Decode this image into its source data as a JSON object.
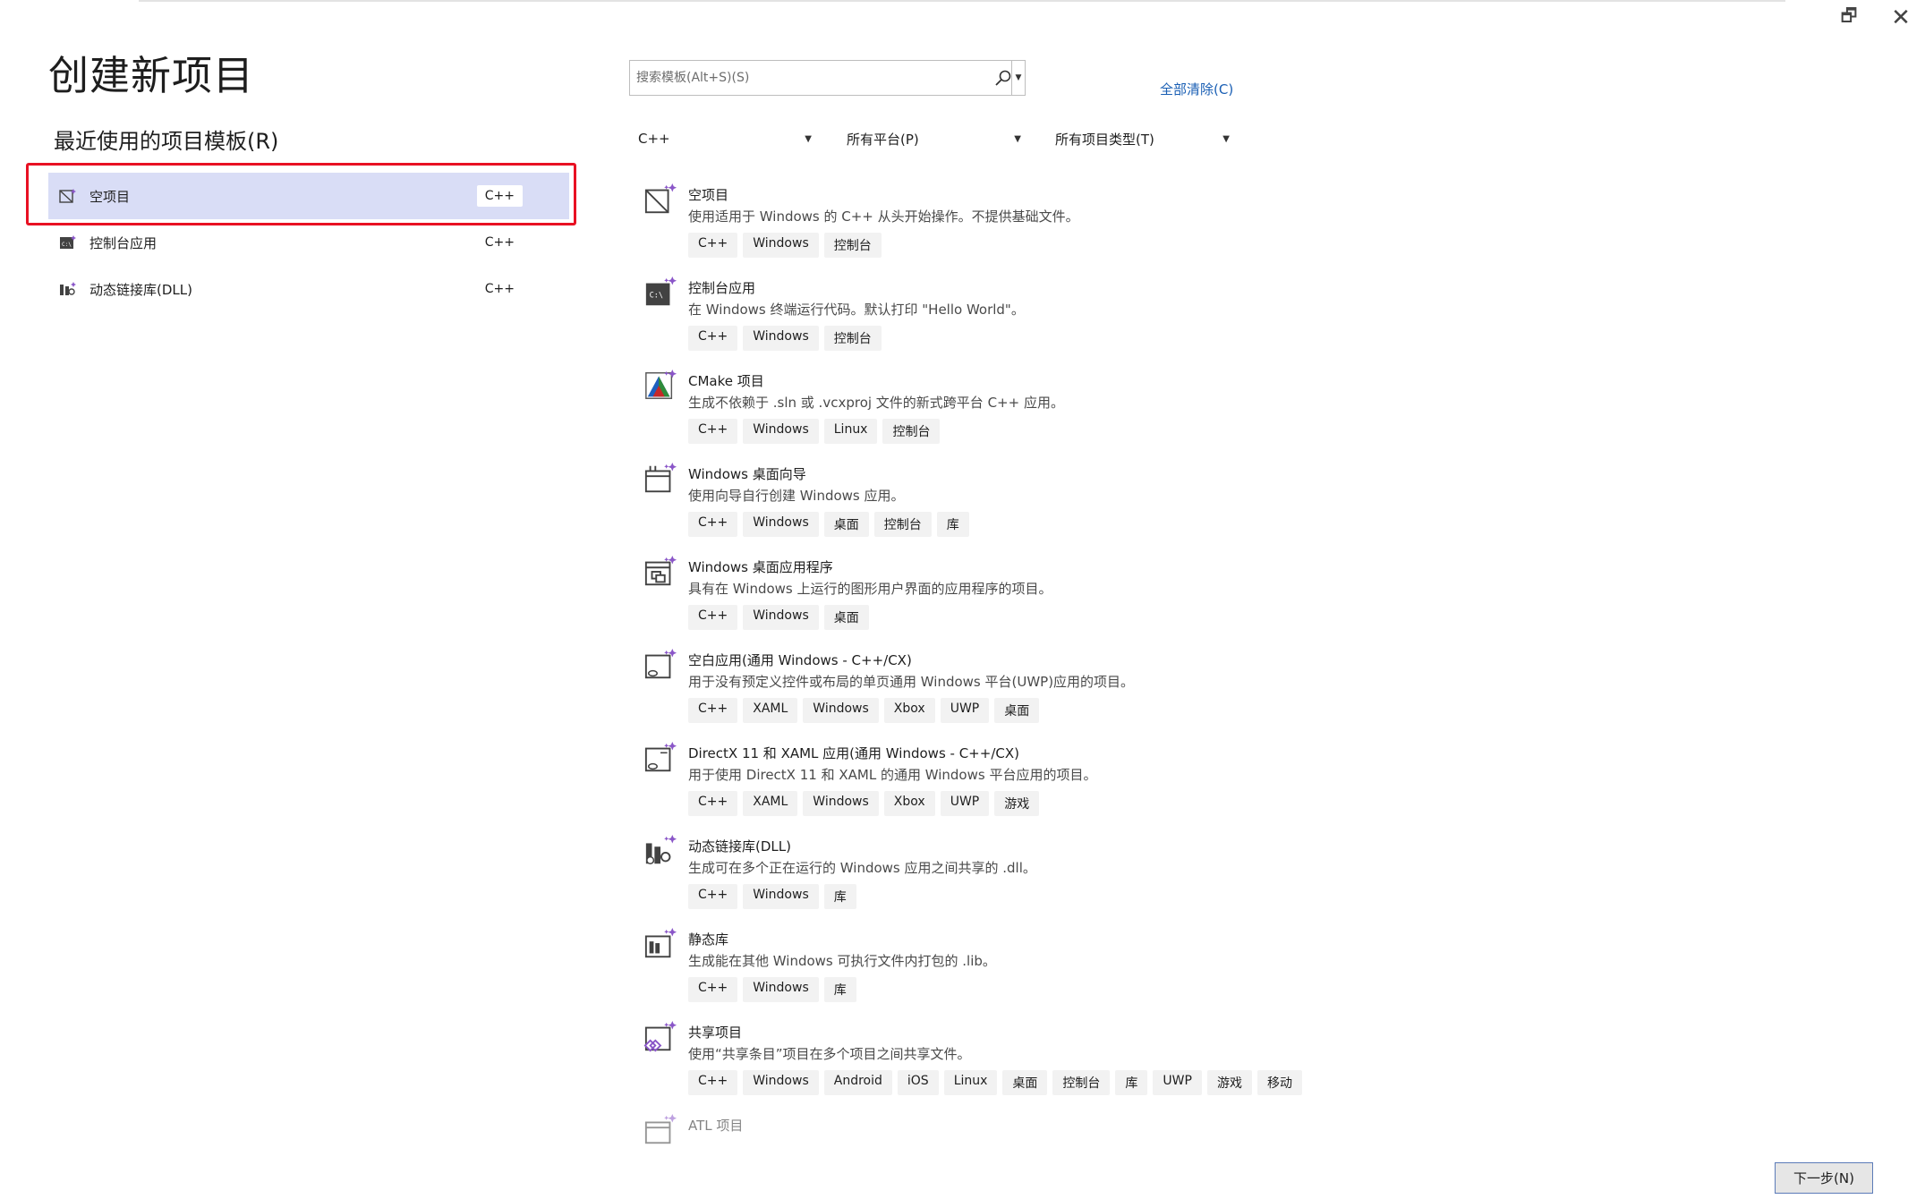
{
  "window": {
    "restore_glyph": "🗗",
    "close_glyph": "✕"
  },
  "page_title": "创建新项目",
  "recent": {
    "title": "最近使用的项目模板(R)",
    "items": [
      {
        "label": "空项目",
        "lang": "C++",
        "icon": "empty-project-icon",
        "selected": true
      },
      {
        "label": "控制台应用",
        "lang": "C++",
        "icon": "console-app-icon",
        "selected": false
      },
      {
        "label": "动态链接库(DLL)",
        "lang": "C++",
        "icon": "dll-icon",
        "selected": false
      }
    ]
  },
  "search": {
    "placeholder": "搜索模板(Alt+S)(S)",
    "value": ""
  },
  "clear_all": "全部清除(C)",
  "filters": {
    "language": "C++",
    "platform": "所有平台(P)",
    "project_type": "所有项目类型(T)"
  },
  "templates": [
    {
      "name": "空项目",
      "desc": "使用适用于 Windows 的 C++ 从头开始操作。不提供基础文件。",
      "tags": [
        "C++",
        "Windows",
        "控制台"
      ],
      "icon": "empty-project-icon"
    },
    {
      "name": "控制台应用",
      "desc": "在 Windows 终端运行代码。默认打印 \"Hello World\"。",
      "tags": [
        "C++",
        "Windows",
        "控制台"
      ],
      "icon": "console-app-icon"
    },
    {
      "name": "CMake 项目",
      "desc": "生成不依赖于 .sln 或 .vcxproj 文件的新式跨平台 C++ 应用。",
      "tags": [
        "C++",
        "Windows",
        "Linux",
        "控制台"
      ],
      "icon": "cmake-icon"
    },
    {
      "name": "Windows 桌面向导",
      "desc": "使用向导自行创建 Windows 应用。",
      "tags": [
        "C++",
        "Windows",
        "桌面",
        "控制台",
        "库"
      ],
      "icon": "desktop-wizard-icon"
    },
    {
      "name": "Windows 桌面应用程序",
      "desc": "具有在 Windows 上运行的图形用户界面的应用程序的项目。",
      "tags": [
        "C++",
        "Windows",
        "桌面"
      ],
      "icon": "desktop-app-icon"
    },
    {
      "name": "空白应用(通用 Windows - C++/CX)",
      "desc": "用于没有预定义控件或布局的单页通用 Windows 平台(UWP)应用的项目。",
      "tags": [
        "C++",
        "XAML",
        "Windows",
        "Xbox",
        "UWP",
        "桌面"
      ],
      "icon": "uwp-blank-app-icon"
    },
    {
      "name": "DirectX 11 和 XAML 应用(通用 Windows - C++/CX)",
      "desc": "用于使用 DirectX 11 和 XAML 的通用 Windows 平台应用的项目。",
      "tags": [
        "C++",
        "XAML",
        "Windows",
        "Xbox",
        "UWP",
        "游戏"
      ],
      "icon": "directx-app-icon"
    },
    {
      "name": "动态链接库(DLL)",
      "desc": "生成可在多个正在运行的 Windows 应用之间共享的 .dll。",
      "tags": [
        "C++",
        "Windows",
        "库"
      ],
      "icon": "dll-icon"
    },
    {
      "name": "静态库",
      "desc": "生成能在其他 Windows 可执行文件内打包的 .lib。",
      "tags": [
        "C++",
        "Windows",
        "库"
      ],
      "icon": "static-lib-icon"
    },
    {
      "name": "共享项目",
      "desc": "使用“共享条目”项目在多个项目之间共享文件。",
      "tags": [
        "C++",
        "Windows",
        "Android",
        "iOS",
        "Linux",
        "桌面",
        "控制台",
        "库",
        "UWP",
        "游戏",
        "移动"
      ],
      "icon": "shared-project-icon"
    },
    {
      "name": "ATL 项目",
      "desc": "",
      "tags": [],
      "icon": "atl-project-icon"
    }
  ],
  "next_button": "下一步(N)",
  "colors": {
    "selection": "#d9ddf6",
    "highlight": "#e81123",
    "link": "#1a5fb4",
    "accent_purple": "#8a56c8"
  }
}
